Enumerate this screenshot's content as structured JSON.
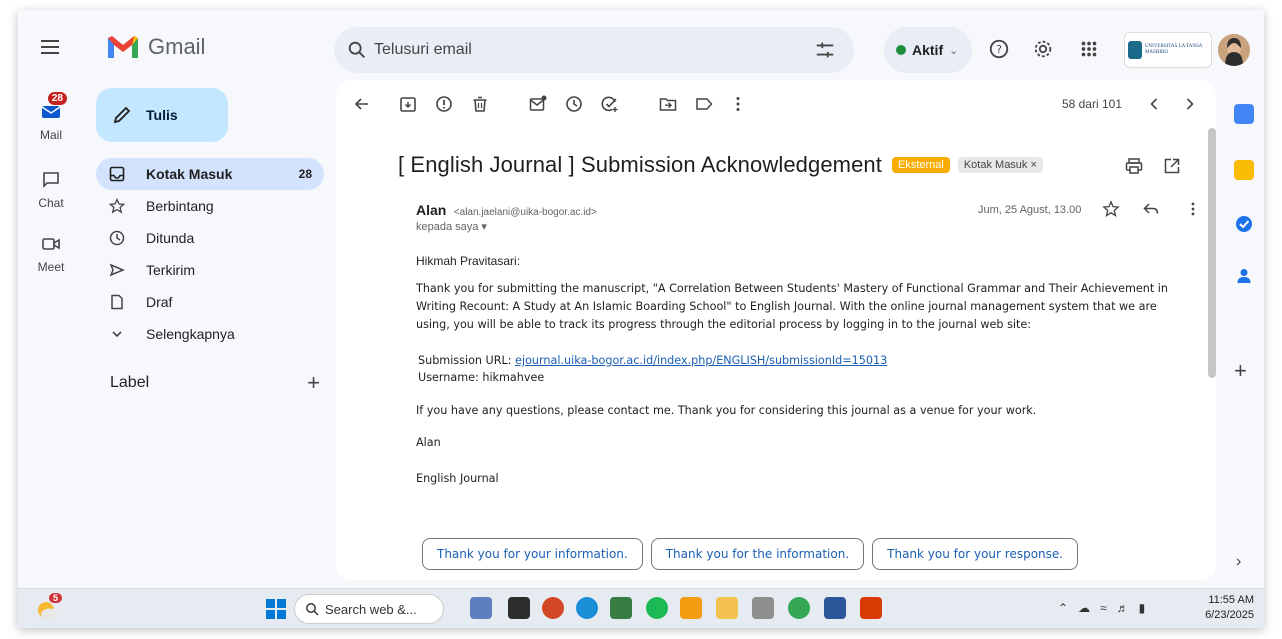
{
  "header": {
    "app_name": "Gmail",
    "search_placeholder": "Telusuri email",
    "status_label": "Aktif",
    "org_text": "UNIVERSITAS LA TANSA MASHIRO"
  },
  "rail": {
    "mail_label": "Mail",
    "mail_badge": "28",
    "chat_label": "Chat",
    "meet_label": "Meet"
  },
  "sidebar": {
    "compose_label": "Tulis",
    "items": [
      {
        "label": "Kotak Masuk",
        "count": "28",
        "icon": "inbox-icon"
      },
      {
        "label": "Berbintang",
        "count": "",
        "icon": "star-icon"
      },
      {
        "label": "Ditunda",
        "count": "",
        "icon": "clock-icon"
      },
      {
        "label": "Terkirim",
        "count": "",
        "icon": "send-icon"
      },
      {
        "label": "Draf",
        "count": "",
        "icon": "draft-icon"
      },
      {
        "label": "Selengkapnya",
        "count": "",
        "icon": "chevron-down-icon"
      }
    ],
    "labels_heading": "Label",
    "labels_add": "+"
  },
  "toolbar": {
    "pager_text": "58 dari 101"
  },
  "email": {
    "subject": "[ English Journal ] Submission Acknowledgement",
    "tag_external": "Eksternal",
    "tag_inbox": "Kotak Masuk ×",
    "sender_name": "Alan",
    "sender_email": "<alan.jaelani@uika-bogor.ac.id>",
    "recipient": "kepada saya ▾",
    "date": "Jum, 25 Agust, 13.00",
    "salutation": "Hikmah Pravitasari:",
    "paragraph1": "Thank you for submitting the manuscript, \"A Correlation Between Students' Mastery of Functional Grammar and Their Achievement in Writing  Recount: A Study at An Islamic Boarding School\" to English Journal. With the online journal management system that we are using, you will be able to track its progress through the editorial process by logging in to the journal web site:",
    "url_label": "Submission URL:",
    "url": "ejournal.uika-bogor.ac.id/index.php/ENGLISH/submissionId=15013",
    "username_line": "Username: hikmahvee",
    "paragraph2": "If you have any questions, please contact me. Thank you for considering this journal as a venue for your work.",
    "signature_name": "Alan",
    "signature_org": "English Journal"
  },
  "smart_replies": [
    "Thank you for your information.",
    "Thank you for the information.",
    "Thank you for your response."
  ],
  "taskbar": {
    "weather_badge": "5",
    "search_placeholder": "Search web &...",
    "time": "11:55 AM",
    "date": "6/23/2025"
  },
  "colors": {
    "accent": "#d3e3fd",
    "compose": "#c2e7ff",
    "link": "#1a5fb4",
    "external_tag": "#f9ab00",
    "badge": "#c5221f"
  }
}
